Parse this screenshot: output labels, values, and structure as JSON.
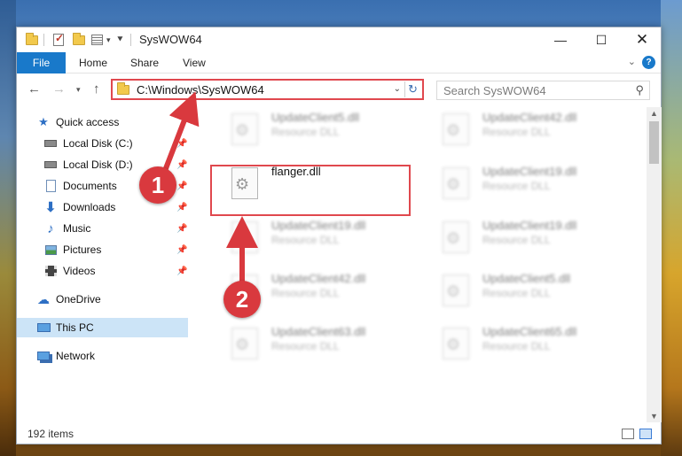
{
  "window": {
    "title": "SysWOW64"
  },
  "ribbon": {
    "tabs": [
      "File",
      "Home",
      "Share",
      "View"
    ],
    "help_label": "?"
  },
  "nav": {
    "address": "C:\\Windows\\SysWOW64",
    "search_placeholder": "Search SysWOW64"
  },
  "sidebar": {
    "items": [
      {
        "label": "Quick access",
        "icon": "star-icon"
      },
      {
        "label": "Local Disk (C:)",
        "icon": "drive-icon",
        "pinned": true
      },
      {
        "label": "Local Disk (D:)",
        "icon": "drive-icon",
        "pinned": true
      },
      {
        "label": "Documents",
        "icon": "documents-icon",
        "pinned": true
      },
      {
        "label": "Downloads",
        "icon": "download-icon",
        "pinned": true
      },
      {
        "label": "Music",
        "icon": "music-icon",
        "pinned": true
      },
      {
        "label": "Pictures",
        "icon": "pictures-icon",
        "pinned": true
      },
      {
        "label": "Videos",
        "icon": "videos-icon",
        "pinned": true
      },
      {
        "label": "OneDrive",
        "icon": "cloud-icon"
      },
      {
        "label": "This PC",
        "icon": "computer-icon",
        "selected": true
      },
      {
        "label": "Network",
        "icon": "network-icon"
      }
    ]
  },
  "files": [
    {
      "name": "UpdateClient5.dll",
      "type": "Resource DLL"
    },
    {
      "name": "UpdateClient42.dll",
      "type": "Resource DLL"
    },
    {
      "name": "flanger.dll",
      "type": ""
    },
    {
      "name": "UpdateClient19.dll",
      "type": "Resource DLL"
    },
    {
      "name": "UpdateClient19.dll",
      "type": "Resource DLL"
    },
    {
      "name": "UpdateClient19.dll",
      "type": "Resource DLL"
    },
    {
      "name": "UpdateClient42.dll",
      "type": "Resource DLL"
    },
    {
      "name": "UpdateClient5.dll",
      "type": "Resource DLL"
    },
    {
      "name": "UpdateClient63.dll",
      "type": "Resource DLL"
    },
    {
      "name": "UpdateClient65.dll",
      "type": "Resource DLL"
    }
  ],
  "status": {
    "item_count": "192 items"
  },
  "annotations": {
    "step1": "1",
    "step2": "2"
  },
  "colors": {
    "accent": "#1979ca",
    "highlight": "#e0484e",
    "badge": "#d9393e",
    "selection": "#cce4f7"
  }
}
